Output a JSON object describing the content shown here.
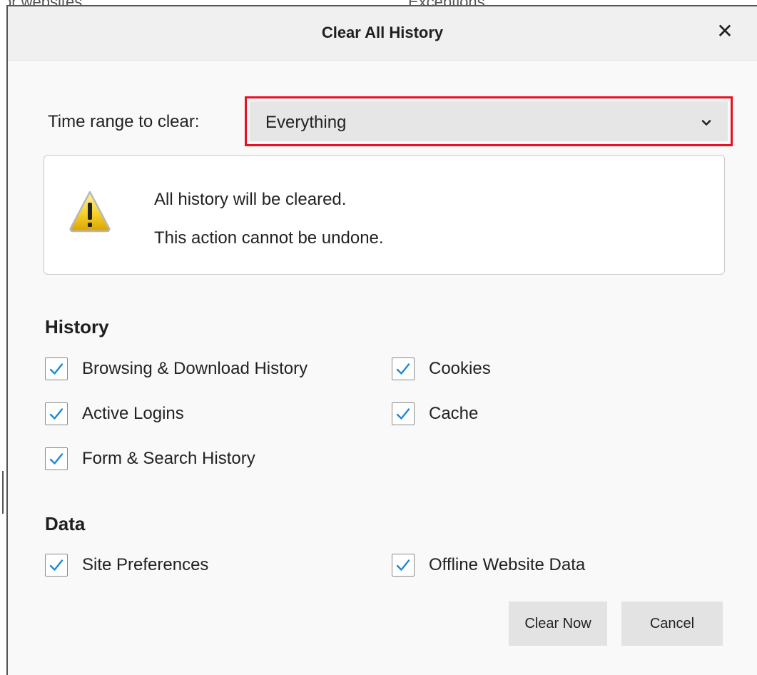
{
  "background": {
    "left_text": "or websites",
    "right_text": "Exceptions"
  },
  "dialog": {
    "title": "Clear All History",
    "close_glyph": "✕"
  },
  "time_range": {
    "label": "Time range to clear:",
    "selected": "Everything",
    "highlight_color": "#e81123"
  },
  "warning": {
    "icon": "warning-triangle-icon",
    "line1": "All history will be cleared.",
    "line2": "This action cannot be undone."
  },
  "history": {
    "title": "History",
    "items": [
      {
        "label": "Browsing & Download History",
        "checked": true
      },
      {
        "label": "Cookies",
        "checked": true
      },
      {
        "label": "Active Logins",
        "checked": true
      },
      {
        "label": "Cache",
        "checked": true
      },
      {
        "label": "Form & Search History",
        "checked": true
      }
    ]
  },
  "data": {
    "title": "Data",
    "items": [
      {
        "label": "Site Preferences",
        "checked": true
      },
      {
        "label": "Offline Website Data",
        "checked": true
      }
    ]
  },
  "buttons": {
    "clear_now": "Clear Now",
    "cancel": "Cancel"
  },
  "colors": {
    "check": "#1e88d9",
    "button_bg": "#e3e3e3"
  }
}
